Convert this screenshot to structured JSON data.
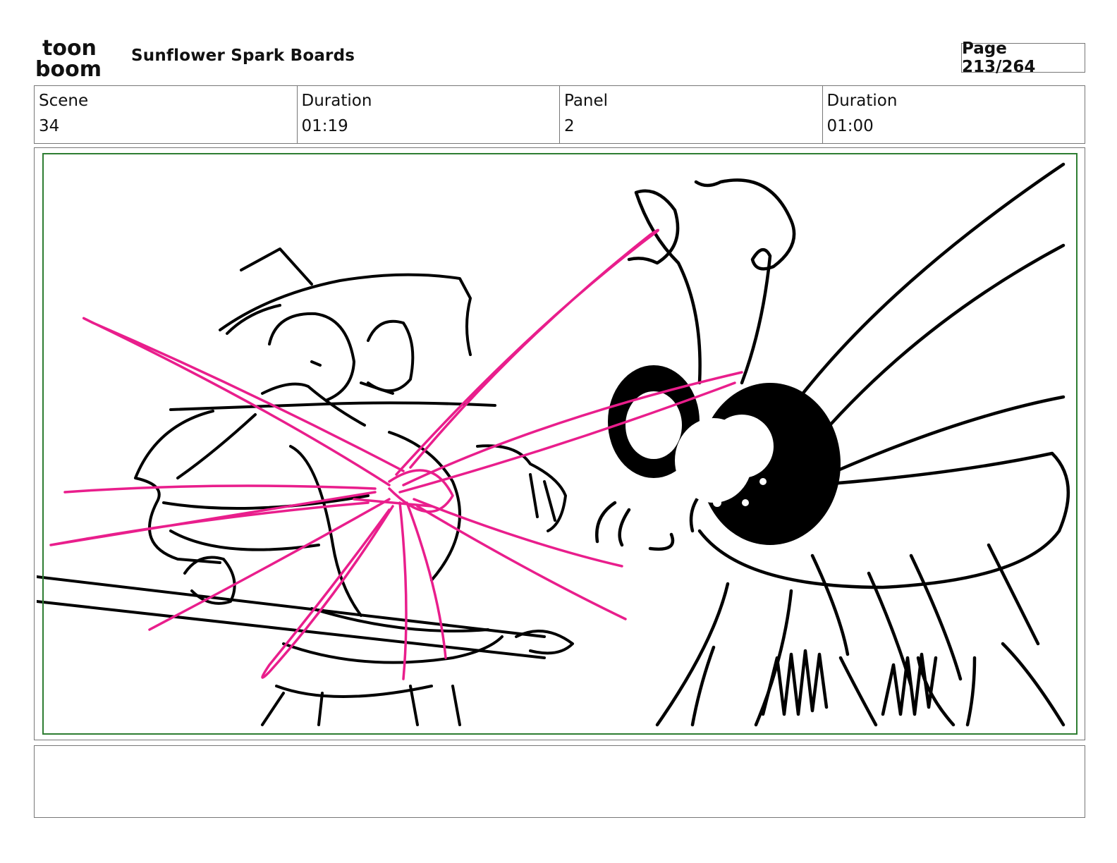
{
  "header": {
    "logo": {
      "line1": "toon",
      "line2": "boom"
    },
    "project_title": "Sunflower Spark Boards",
    "page_label": "Page 213/264"
  },
  "info": {
    "scene_label": "Scene",
    "scene_value": "34",
    "scene_duration_label": "Duration",
    "scene_duration_value": "01:19",
    "panel_label": "Panel",
    "panel_value": "2",
    "panel_duration_label": "Duration",
    "panel_duration_value": "01:00"
  },
  "panel": {
    "safe_frame_color": "#2e7d32",
    "sketch_color": "#000000",
    "effect_color": "#e91e8c"
  },
  "notes": {
    "text": ""
  }
}
